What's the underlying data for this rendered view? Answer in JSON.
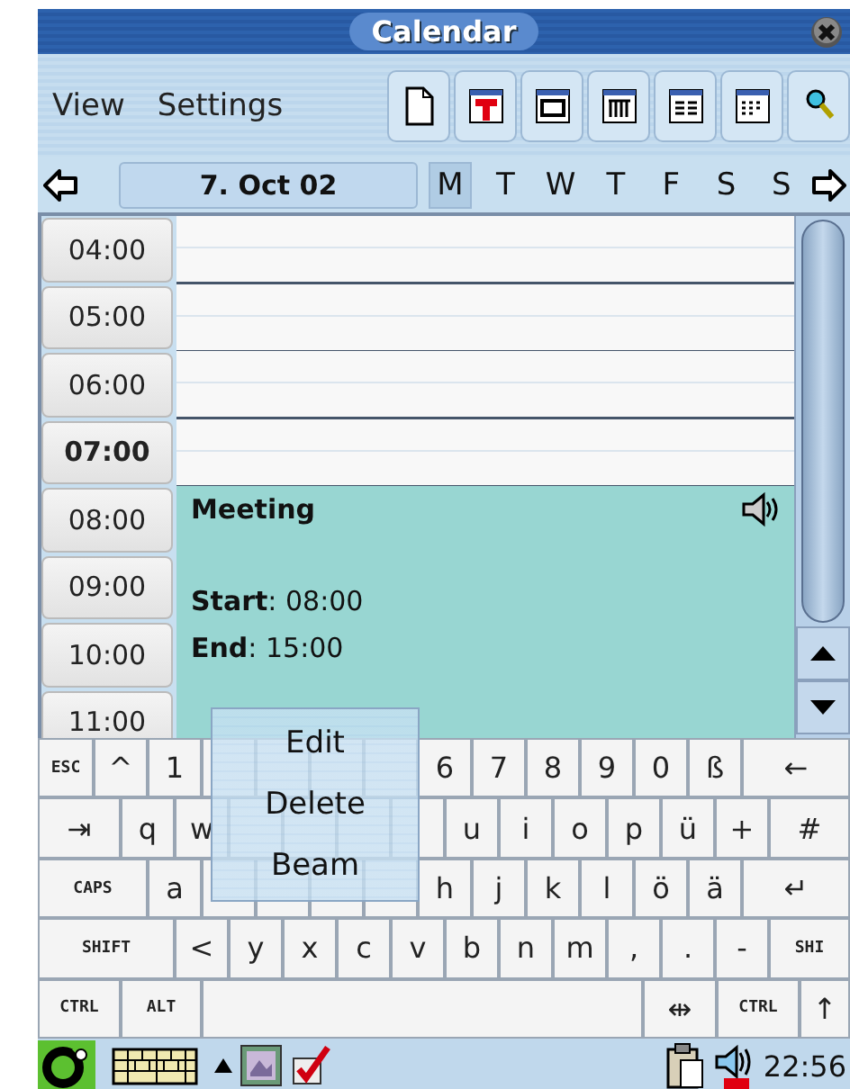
{
  "window": {
    "title": "Calendar"
  },
  "menu": [
    "View",
    "Settings"
  ],
  "toolbar": [
    {
      "kind": "new"
    },
    {
      "kind": "today"
    },
    {
      "kind": "day"
    },
    {
      "kind": "week"
    },
    {
      "kind": "weeklist"
    },
    {
      "kind": "month"
    },
    {
      "kind": "find"
    }
  ],
  "date_nav": {
    "date": "7. Oct 02",
    "days": [
      {
        "label": "M",
        "selected": true
      },
      {
        "label": "T",
        "selected": false
      },
      {
        "label": "W",
        "selected": false
      },
      {
        "label": "T",
        "selected": false
      },
      {
        "label": "F",
        "selected": false
      },
      {
        "label": "S",
        "selected": false
      },
      {
        "label": "S",
        "selected": false
      }
    ]
  },
  "hours": [
    {
      "label": "04:00",
      "current": false
    },
    {
      "label": "05:00",
      "current": false
    },
    {
      "label": "06:00",
      "current": false
    },
    {
      "label": "07:00",
      "current": true
    },
    {
      "label": "08:00",
      "current": false,
      "event": {
        "title": "Meeting",
        "alarm": true,
        "lines": [
          "**Start**: 08:00",
          "**End**: 15:00"
        ]
      }
    },
    {
      "label": "09:00",
      "current": false
    },
    {
      "label": "10:00",
      "current": false
    },
    {
      "label": "11:00",
      "current": false
    }
  ],
  "popup_menu": [
    "Edit",
    "Delete",
    "Beam"
  ],
  "keyboard": [
    [
      {
        "kind": "esc",
        "label": "ESC"
      },
      {
        "kind": "key",
        "label": "^"
      },
      {
        "kind": "key",
        "label": "1"
      },
      {
        "kind": "blank"
      },
      {
        "kind": "blank"
      },
      {
        "kind": "blank"
      },
      {
        "kind": "blank"
      },
      {
        "kind": "key",
        "label": "6"
      },
      {
        "kind": "key",
        "label": "7"
      },
      {
        "kind": "key",
        "label": "8"
      },
      {
        "kind": "key",
        "label": "9"
      },
      {
        "kind": "key",
        "label": "0"
      },
      {
        "kind": "key",
        "label": "ß"
      },
      {
        "kind": "end",
        "label": "←"
      }
    ],
    [
      {
        "kind": "tab",
        "label": "⇥"
      },
      {
        "kind": "key",
        "label": "q"
      },
      {
        "kind": "key",
        "label": "w"
      },
      {
        "kind": "blank"
      },
      {
        "kind": "blank"
      },
      {
        "kind": "blank"
      },
      {
        "kind": "blank"
      },
      {
        "kind": "key",
        "label": "u"
      },
      {
        "kind": "key",
        "label": "i"
      },
      {
        "kind": "key",
        "label": "o"
      },
      {
        "kind": "key",
        "label": "p"
      },
      {
        "kind": "key",
        "label": "ü"
      },
      {
        "kind": "key",
        "label": "+"
      },
      {
        "kind": "end",
        "label": "#"
      }
    ],
    [
      {
        "kind": "caps",
        "label": "CAPS"
      },
      {
        "kind": "key",
        "label": "a"
      },
      {
        "kind": "blank"
      },
      {
        "kind": "blank"
      },
      {
        "kind": "blank"
      },
      {
        "kind": "blank"
      },
      {
        "kind": "key",
        "label": "h"
      },
      {
        "kind": "key",
        "label": "j"
      },
      {
        "kind": "key",
        "label": "k"
      },
      {
        "kind": "key",
        "label": "l"
      },
      {
        "kind": "key",
        "label": "ö"
      },
      {
        "kind": "key",
        "label": "ä"
      },
      {
        "kind": "end",
        "label": "↵"
      }
    ],
    [
      {
        "kind": "shift",
        "label": "SHIFT"
      },
      {
        "kind": "key",
        "label": "<"
      },
      {
        "kind": "key",
        "label": "y"
      },
      {
        "kind": "key",
        "label": "x"
      },
      {
        "kind": "key",
        "label": "c"
      },
      {
        "kind": "key",
        "label": "v"
      },
      {
        "kind": "key",
        "label": "b"
      },
      {
        "kind": "key",
        "label": "n"
      },
      {
        "kind": "key",
        "label": "m"
      },
      {
        "kind": "key",
        "label": ","
      },
      {
        "kind": "key",
        "label": "."
      },
      {
        "kind": "key",
        "label": "-"
      },
      {
        "kind": "endmod",
        "label": "SHI"
      }
    ],
    [
      {
        "kind": "ctrl",
        "label": "CTRL"
      },
      {
        "kind": "alt",
        "label": "ALT"
      },
      {
        "kind": "space"
      },
      {
        "kind": "mid",
        "label": "⇹"
      },
      {
        "kind": "ctrl",
        "label": "CTRL"
      },
      {
        "kind": "end",
        "label": "↑"
      }
    ]
  ],
  "taskbar": {
    "clock": "22:56"
  }
}
